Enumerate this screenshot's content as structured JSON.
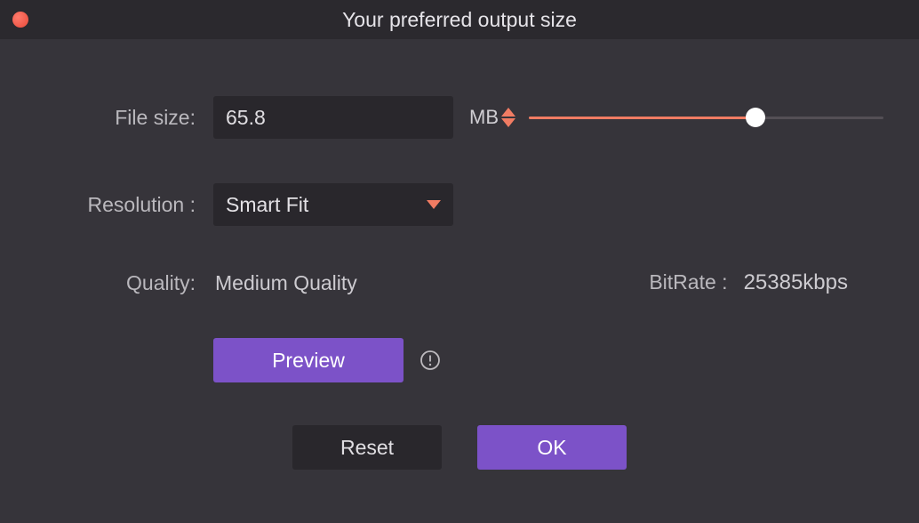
{
  "window": {
    "title": "Your preferred output size"
  },
  "file_size": {
    "label": "File size:",
    "value": "65.8",
    "unit": "MB",
    "slider_percent": 64
  },
  "resolution": {
    "label": "Resolution :",
    "selected": "Smart Fit"
  },
  "quality": {
    "label": "Quality:",
    "value": "Medium Quality"
  },
  "bitrate": {
    "label": "BitRate :",
    "value": "25385kbps"
  },
  "buttons": {
    "preview": "Preview",
    "reset": "Reset",
    "ok": "OK"
  }
}
